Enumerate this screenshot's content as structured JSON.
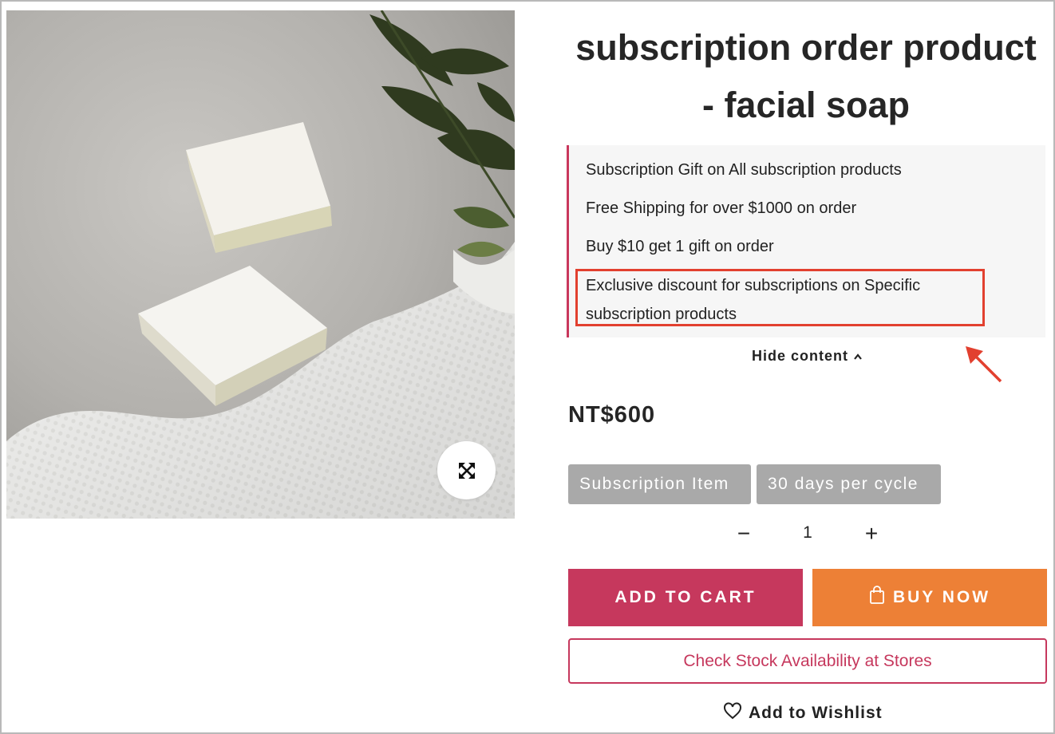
{
  "product": {
    "title": "subscription order product - facial soap",
    "image_alt": "facial soap bars on grey stone with white towel and green leaves",
    "price": "NT$600"
  },
  "promotions": {
    "items": [
      "Subscription Gift on All subscription products",
      "Free Shipping for over $1000 on order",
      "Buy $10 get 1 gift on order"
    ],
    "highlighted_line1": "Exclusive discount for subscriptions on Specific",
    "highlighted_line2": "subscription products",
    "toggle_label": "Hide content"
  },
  "tags": {
    "subscription": "Subscription Item",
    "cycle": "30 days per cycle"
  },
  "quantity": {
    "minus": "−",
    "value": "1",
    "plus": "+"
  },
  "actions": {
    "add_to_cart": "ADD TO CART",
    "buy_now": "BUY NOW",
    "check_stock": "Check Stock Availability at Stores",
    "wishlist": "Add to Wishlist"
  },
  "colors": {
    "accent_pink": "#c6385d",
    "buy_orange": "#ed8036",
    "tag_grey": "#a9a9a9",
    "annotation_red": "#e2402f"
  },
  "icons": {
    "zoom": "expand-icon",
    "hide_toggle": "chevron-up-icon",
    "buy": "shopping-bag-icon",
    "wishlist": "heart-icon",
    "annotation": "arrow-icon"
  }
}
